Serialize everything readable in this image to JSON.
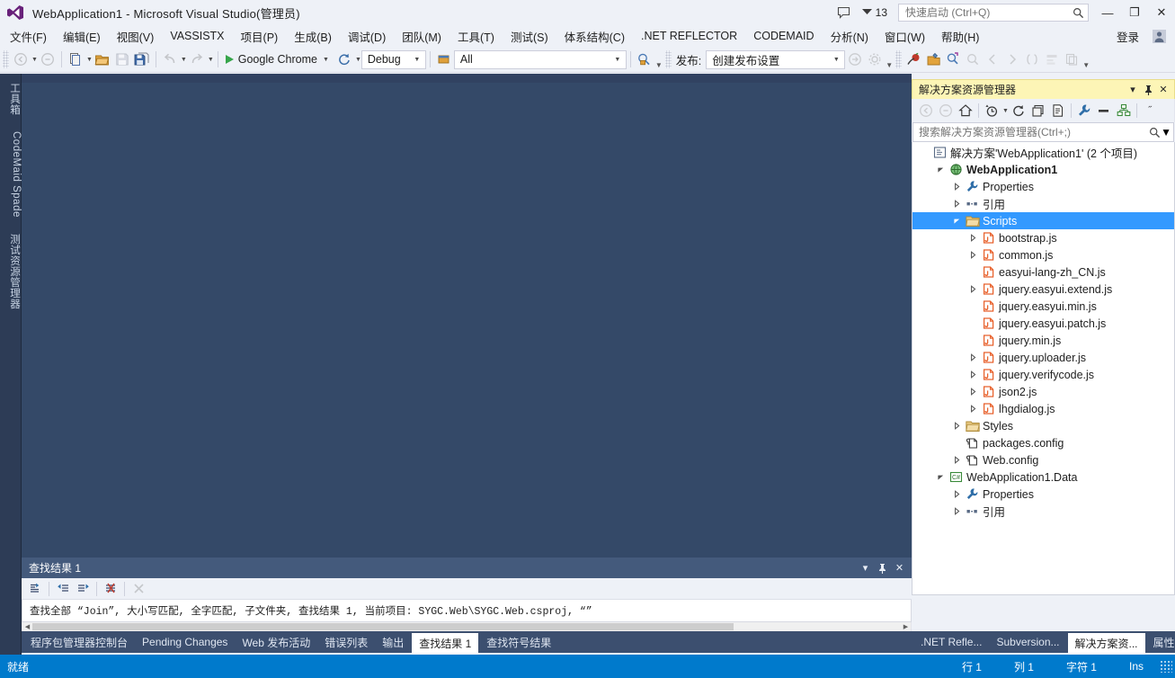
{
  "window": {
    "title": "WebApplication1 - Microsoft Visual Studio(管理员)",
    "logo_icon": "visual-studio-logo",
    "feedback_icon": "feedback-smiley-icon",
    "notification_icon": "notification-flag-icon",
    "notification_count": "13",
    "minimize_label": "—",
    "maximize_label": "❐",
    "close_label": "✕"
  },
  "quick_launch": {
    "placeholder": "快速启动 (Ctrl+Q)",
    "value": "",
    "icon": "search-icon"
  },
  "menu": {
    "items": [
      {
        "label": "文件(F)"
      },
      {
        "label": "编辑(E)"
      },
      {
        "label": "视图(V)"
      },
      {
        "label": "VASSISTX"
      },
      {
        "label": "项目(P)"
      },
      {
        "label": "生成(B)"
      },
      {
        "label": "调试(D)"
      },
      {
        "label": "团队(M)"
      },
      {
        "label": "工具(T)"
      },
      {
        "label": "测试(S)"
      },
      {
        "label": "体系结构(C)"
      },
      {
        "label": ".NET REFLECTOR"
      },
      {
        "label": "CODEMAID"
      },
      {
        "label": "分析(N)"
      },
      {
        "label": "窗口(W)"
      },
      {
        "label": "帮助(H)"
      }
    ],
    "signin_label": "登录",
    "user_icon": "user-account-icon"
  },
  "toolbar": {
    "nav_back_icon": "navigate-back-icon",
    "nav_forward_icon": "navigate-forward-icon",
    "new_project_icon": "new-project-icon",
    "open_file_icon": "open-file-icon",
    "save_icon": "save-icon",
    "save_all_icon": "save-all-icon",
    "undo_icon": "undo-icon",
    "redo_icon": "redo-icon",
    "start_icon": "start-debug-play-icon",
    "start_label": "Google Chrome",
    "refresh_icon": "refresh-browser-icon",
    "config_value": "Debug",
    "platform_icon": "platform-target-icon",
    "platform_value": "All",
    "find_icon": "find-in-files-icon",
    "publish_label": "发布:",
    "publish_value": "创建发布设置",
    "publish_run_icon": "publish-run-icon",
    "publish_settings_icon": "publish-settings-gear-icon",
    "ext_icons": [
      "reflector-icon",
      "codemaid-icon",
      "vassistx-icon",
      "find-symbol-icon",
      "goto-prev-icon",
      "goto-next-icon",
      "surround-icon",
      "refactor-icon",
      "paste-icon"
    ]
  },
  "left_strip": {
    "tabs": [
      {
        "label": "工具箱",
        "name": "toolbox"
      },
      {
        "label": "CodeMaid Spade",
        "name": "codemaid-spade"
      },
      {
        "label": "测试资源管理器",
        "name": "test-explorer"
      }
    ]
  },
  "solution_explorer": {
    "title": "解决方案资源管理器",
    "title_dropdown_icon": "chevron-down-icon",
    "title_pin_icon": "pin-icon",
    "title_close_icon": "close-icon",
    "toolbar": {
      "back_icon": "navigate-back-icon",
      "forward_icon": "navigate-forward-icon",
      "home_icon": "home-icon",
      "pending_changes_icon": "pending-changes-clock-icon",
      "pending_dropdown_icon": "chevron-down-icon",
      "refresh_icon": "refresh-icon",
      "collapse_all_icon": "collapse-all-icon",
      "show_all_files_icon": "show-all-files-icon",
      "properties_icon": "properties-wrench-icon",
      "preview_icon": "preview-selected-items-icon",
      "dependency_icon": "view-class-diagram-icon",
      "overflow_icon": "overflow-chevrons-icon"
    },
    "search": {
      "placeholder": "搜索解决方案资源管理器(Ctrl+;)",
      "value": "",
      "icon": "search-icon",
      "dropdown_icon": "chevron-down-icon"
    },
    "tree": [
      {
        "label": "解决方案'WebApplication1' (2 个项目)",
        "indent": 0,
        "twisty": "none",
        "icon": "solution-icon",
        "bold": false,
        "selected": false
      },
      {
        "label": "WebApplication1",
        "indent": 1,
        "twisty": "open",
        "icon": "web-project-icon",
        "bold": true,
        "selected": false
      },
      {
        "label": "Properties",
        "indent": 2,
        "twisty": "closed",
        "icon": "properties-wrench-icon",
        "bold": false,
        "selected": false
      },
      {
        "label": "引用",
        "indent": 2,
        "twisty": "closed",
        "icon": "references-icon",
        "bold": false,
        "selected": false
      },
      {
        "label": "Scripts",
        "indent": 2,
        "twisty": "open",
        "icon": "folder-icon",
        "bold": false,
        "selected": true
      },
      {
        "label": "bootstrap.js",
        "indent": 3,
        "twisty": "closed",
        "icon": "js-file-icon",
        "bold": false,
        "selected": false
      },
      {
        "label": "common.js",
        "indent": 3,
        "twisty": "closed",
        "icon": "js-file-icon",
        "bold": false,
        "selected": false
      },
      {
        "label": "easyui-lang-zh_CN.js",
        "indent": 3,
        "twisty": "none",
        "icon": "js-file-icon",
        "bold": false,
        "selected": false
      },
      {
        "label": "jquery.easyui.extend.js",
        "indent": 3,
        "twisty": "closed",
        "icon": "js-file-icon",
        "bold": false,
        "selected": false
      },
      {
        "label": "jquery.easyui.min.js",
        "indent": 3,
        "twisty": "none",
        "icon": "js-file-icon",
        "bold": false,
        "selected": false
      },
      {
        "label": "jquery.easyui.patch.js",
        "indent": 3,
        "twisty": "none",
        "icon": "js-file-icon",
        "bold": false,
        "selected": false
      },
      {
        "label": "jquery.min.js",
        "indent": 3,
        "twisty": "none",
        "icon": "js-file-icon",
        "bold": false,
        "selected": false
      },
      {
        "label": "jquery.uploader.js",
        "indent": 3,
        "twisty": "closed",
        "icon": "js-file-icon",
        "bold": false,
        "selected": false
      },
      {
        "label": "jquery.verifycode.js",
        "indent": 3,
        "twisty": "closed",
        "icon": "js-file-icon",
        "bold": false,
        "selected": false
      },
      {
        "label": "json2.js",
        "indent": 3,
        "twisty": "closed",
        "icon": "js-file-icon",
        "bold": false,
        "selected": false
      },
      {
        "label": "lhgdialog.js",
        "indent": 3,
        "twisty": "closed",
        "icon": "js-file-icon",
        "bold": false,
        "selected": false
      },
      {
        "label": "Styles",
        "indent": 2,
        "twisty": "closed",
        "icon": "folder-icon",
        "bold": false,
        "selected": false
      },
      {
        "label": "packages.config",
        "indent": 2,
        "twisty": "none",
        "icon": "config-file-icon",
        "bold": false,
        "selected": false
      },
      {
        "label": "Web.config",
        "indent": 2,
        "twisty": "closed",
        "icon": "config-file-icon",
        "bold": false,
        "selected": false
      },
      {
        "label": "WebApplication1.Data",
        "indent": 1,
        "twisty": "open",
        "icon": "csharp-project-icon",
        "bold": false,
        "selected": false
      },
      {
        "label": "Properties",
        "indent": 2,
        "twisty": "closed",
        "icon": "properties-wrench-icon",
        "bold": false,
        "selected": false
      },
      {
        "label": "引用",
        "indent": 2,
        "twisty": "closed",
        "icon": "references-icon",
        "bold": false,
        "selected": false
      }
    ]
  },
  "find_results": {
    "title": "查找结果 1",
    "dropdown_icon": "chevron-down-icon",
    "pin_icon": "pin-icon",
    "close_icon": "close-icon",
    "toolbar_icons": [
      "go-to-location-icon",
      "previous-location-icon",
      "next-location-icon",
      "clear-results-icon",
      "cancel-icon"
    ],
    "line": "查找全部 “Join”, 大小写匹配, 全字匹配, 子文件夹, 查找结果 1, 当前项目: SYGC.Web\\SYGC.Web.csproj, “”"
  },
  "bottom_tabs": {
    "items": [
      {
        "label": "程序包管理器控制台",
        "active": false
      },
      {
        "label": "Pending Changes",
        "active": false
      },
      {
        "label": "Web 发布活动",
        "active": false
      },
      {
        "label": "错误列表",
        "active": false
      },
      {
        "label": "输出",
        "active": false
      },
      {
        "label": "查找结果 1",
        "active": true
      },
      {
        "label": "查找符号结果",
        "active": false
      }
    ]
  },
  "right_tabs": {
    "items": [
      {
        "label": ".NET Refle...",
        "active": false
      },
      {
        "label": "Subversion...",
        "active": false
      },
      {
        "label": "解决方案资...",
        "active": true
      },
      {
        "label": "属性",
        "active": false
      }
    ]
  },
  "status_bar": {
    "ready": "就绪",
    "line": "行 1",
    "column": "列 1",
    "character": "字符 1",
    "insert_mode": "Ins",
    "accent_color": "#007acc"
  },
  "colors": {
    "chrome": "#eef1f7",
    "editor_background": "#344968",
    "selection": "#3399ff",
    "panel_header": "#445a7c",
    "tool_title": "#fdf5b6",
    "tab_strip": "#3c4f6f",
    "status": "#007acc",
    "js_icon": "#e8622d",
    "folder": "#dcb67a"
  }
}
